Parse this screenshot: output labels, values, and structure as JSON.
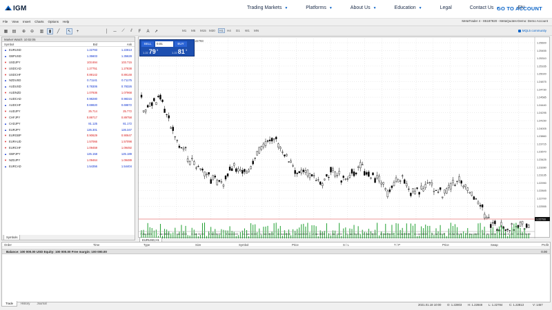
{
  "site": {
    "logo_text": "IGM",
    "nav": [
      {
        "label": "Trading Markets",
        "dropdown": true
      },
      {
        "label": "Platforms",
        "dropdown": true
      },
      {
        "label": "About Us",
        "dropdown": true
      },
      {
        "label": "Education",
        "dropdown": true
      },
      {
        "label": "Legal",
        "dropdown": false
      },
      {
        "label": "Contact Us",
        "dropdown": true
      },
      {
        "label": "EN",
        "dropdown": false
      }
    ],
    "cta": "GO TO ACCOUNT",
    "brand_color": "#0a64c8"
  },
  "terminal_app": {
    "menu": [
      "File",
      "View",
      "Insert",
      "Charts",
      "Options",
      "Help"
    ],
    "window_title": "MetaTrader 4 - 85187920 - MetaQuotes-Demo: Demo Account",
    "timeframes": [
      "M1",
      "M5",
      "M15",
      "M30",
      "H1",
      "H4",
      "D1",
      "W1",
      "MN"
    ],
    "active_timeframe": "H1",
    "mql_link": "MQL5 community",
    "toolbar_icons": [
      "new-chart-icon",
      "profiles-icon",
      "zoom-in-icon",
      "zoom-out-icon",
      "bar-chart-icon",
      "candlestick-icon",
      "line-chart-icon",
      "cursor-icon",
      "crosshair-icon",
      "vertical-line-icon",
      "horizontal-line-icon",
      "trendline-icon",
      "channel-icon",
      "fibonacci-icon",
      "text-icon",
      "arrow-icon"
    ]
  },
  "market_watch": {
    "title": "Market Watch: 10:02:05",
    "columns": [
      "Symbol",
      "Bid",
      "Ask"
    ],
    "rows": [
      {
        "symbol": "EURUSD",
        "bid": "1.22793",
        "ask": "1.22813",
        "dir": "up"
      },
      {
        "symbol": "GBPUSD",
        "bid": "1.35603",
        "ask": "1.35628",
        "dir": "up"
      },
      {
        "symbol": "USDJPY",
        "bid": "103.694",
        "ask": "103.715",
        "dir": "down"
      },
      {
        "symbol": "USDCAD",
        "bid": "1.27751",
        "ask": "1.27838",
        "dir": "down"
      },
      {
        "symbol": "USDCHF",
        "bid": "0.89142",
        "ask": "0.89148",
        "dir": "down"
      },
      {
        "symbol": "NZDUSD",
        "bid": "0.71141",
        "ask": "0.71175",
        "dir": "up"
      },
      {
        "symbol": "AUDUSD",
        "bid": "0.78306",
        "ask": "0.78326",
        "dir": "up"
      },
      {
        "symbol": "AUDNZD",
        "bid": "1.07936",
        "ask": "1.07968",
        "dir": "down"
      },
      {
        "symbol": "AUDCAD",
        "bid": "0.98280",
        "ask": "0.98315",
        "dir": "up"
      },
      {
        "symbol": "AUDCHF",
        "bid": "0.69820",
        "ask": "0.69872",
        "dir": "up"
      },
      {
        "symbol": "AUDJPY",
        "bid": "25.714",
        "ask": "25.772",
        "dir": "down"
      },
      {
        "symbol": "CHFJPY",
        "bid": "0.89717",
        "ask": "0.89758",
        "dir": "down"
      },
      {
        "symbol": "CADJPY",
        "bid": "81.125",
        "ask": "81.172",
        "dir": "up"
      },
      {
        "symbol": "EURJPY",
        "bid": "126.301",
        "ask": "126.347",
        "dir": "up"
      },
      {
        "symbol": "EURGBP",
        "bid": "0.90629",
        "ask": "0.90647",
        "dir": "down"
      },
      {
        "symbol": "EURAUD",
        "bid": "1.57066",
        "ask": "1.57098",
        "dir": "down"
      },
      {
        "symbol": "EURCHF",
        "bid": "1.09459",
        "ask": "1.09492",
        "dir": "down"
      },
      {
        "symbol": "GBPJPY",
        "bid": "125.158",
        "ask": "125.189",
        "dir": "up"
      },
      {
        "symbol": "NZDJPY",
        "bid": "1.09464",
        "ask": "1.09489",
        "dir": "down"
      },
      {
        "symbol": "EURCAD",
        "bid": "1.54356",
        "ask": "1.54404",
        "dir": "up"
      }
    ],
    "tab": "Symbols",
    "up_color": "#0a2fd0",
    "down_color": "#d81818"
  },
  "chart": {
    "label": "EURUSD,H1  1.22798 1.22808 1.22793 1.22793",
    "tab": "EURUSD,H1",
    "one_click": {
      "sell_label": "SELL",
      "buy_label": "BUY",
      "lot": "0.01",
      "sell_small": "1.22",
      "sell_big": "79",
      "sell_sup": "3",
      "buy_small": "1.22",
      "buy_big": "81",
      "buy_sup": "3"
    },
    "current_price_tag": "1.22793",
    "price_labels": [
      "1.25600",
      "1.25455",
      "1.25310",
      "1.25165",
      "1.25020",
      "1.24875",
      "1.24730",
      "1.24585",
      "1.24440",
      "1.24295",
      "1.24150",
      "1.24005",
      "1.23860",
      "1.23715",
      "1.23570",
      "1.23425",
      "1.23280",
      "1.23135",
      "1.22990",
      "1.22845",
      "1.22700",
      "1.22555"
    ],
    "time_labels": [
      "7 Jan 2021",
      "7 Jan 08:00",
      "7 Jan 16:00",
      "8 Jan 00:00",
      "8 Jan 08:00",
      "8 Jan 16:00",
      "11 Jan 00:00",
      "11 Jan 08:00",
      "11 Jan 16:00",
      "12 Jan 00:00",
      "12 Jan 08:00",
      "12 Jan 16:00",
      "13 Jan 00:00",
      "13 Jan 08:00",
      "13 Jan 16:00",
      "14 Jan 00:00",
      "14 Jan 08:00",
      "14 Jan 16:00",
      "15 Jan 00:00",
      "15 Jan 08:00",
      "15 Jan 16:00",
      "18 Jan 00:00",
      "18 Jan 08:00"
    ]
  },
  "terminal_panel": {
    "columns": [
      "Order",
      "Time",
      "Type",
      "Size",
      "Symbol",
      "Price",
      "S / L",
      "T / P",
      "Price",
      "Swap",
      "Profit"
    ],
    "balance_text": "Balance: 100 000.00 USD  Equity: 100 000.00  Free margin: 100 000.00",
    "profit": "0.00",
    "tabs": [
      "Trade",
      "History",
      "Journal"
    ]
  },
  "status_bar": {
    "datetime": "2021.01.18 10:00",
    "open": "O: 1.22803",
    "high": "H: 1.22848",
    "low": "L: 1.22784",
    "close": "C: 1.22813",
    "volume": "V: 1457"
  }
}
